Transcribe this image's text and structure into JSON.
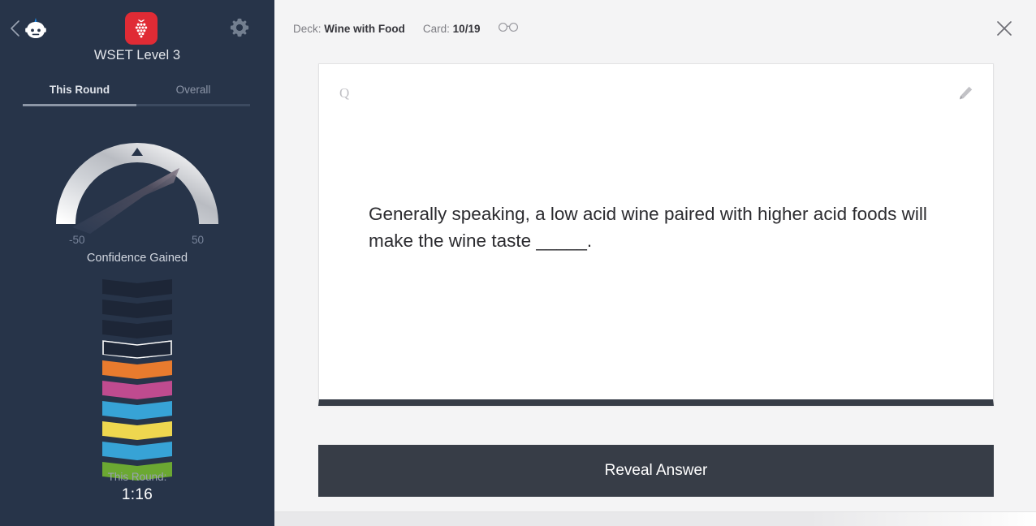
{
  "sidebar": {
    "back_icon": "back-chevron-icon",
    "avatar_icon": "robot-avatar-icon",
    "logo_icon": "grape-cluster-logo",
    "gear_icon": "gear-icon",
    "deck_title": "WSET Level 3",
    "tabs": [
      {
        "label": "This Round",
        "active": true
      },
      {
        "label": "Overall",
        "active": false
      }
    ],
    "gauge": {
      "min_label": "-50",
      "max_label": "50",
      "caption": "Confidence Gained",
      "min": -50,
      "max": 50,
      "value": 22,
      "needle_angle_deg": 45
    },
    "chevrons": [
      {
        "color": "#1d2637",
        "state": "empty"
      },
      {
        "color": "#1d2637",
        "state": "empty"
      },
      {
        "color": "#1d2637",
        "state": "empty"
      },
      {
        "color": "#1d2637",
        "state": "current"
      },
      {
        "color": "#e87b2e",
        "state": "filled"
      },
      {
        "color": "#bf4b8f",
        "state": "filled"
      },
      {
        "color": "#37a3d6",
        "state": "filled"
      },
      {
        "color": "#eed74f",
        "state": "filled"
      },
      {
        "color": "#37a3d6",
        "state": "filled"
      },
      {
        "color": "#6ba832",
        "state": "filled"
      }
    ],
    "round_label": "This Round:",
    "round_time": "1:16"
  },
  "main": {
    "deck_prefix": "Deck:",
    "deck_name": "Wine with Food",
    "card_prefix": "Card:",
    "card_position": "10/19",
    "glasses_icon": "glasses-icon",
    "close_icon": "close-icon",
    "card": {
      "type_marker": "Q",
      "edit_icon": "pencil-edit-icon",
      "question": "Generally speaking, a low acid wine paired with higher acid foods will make the wine taste _____."
    },
    "reveal_label": "Reveal Answer"
  },
  "colors": {
    "sidebar_bg": "#273449",
    "main_bg": "#f4f4f5",
    "accent_red": "#e02b35",
    "dark_button": "#373d47",
    "card_white": "#ffffff"
  }
}
